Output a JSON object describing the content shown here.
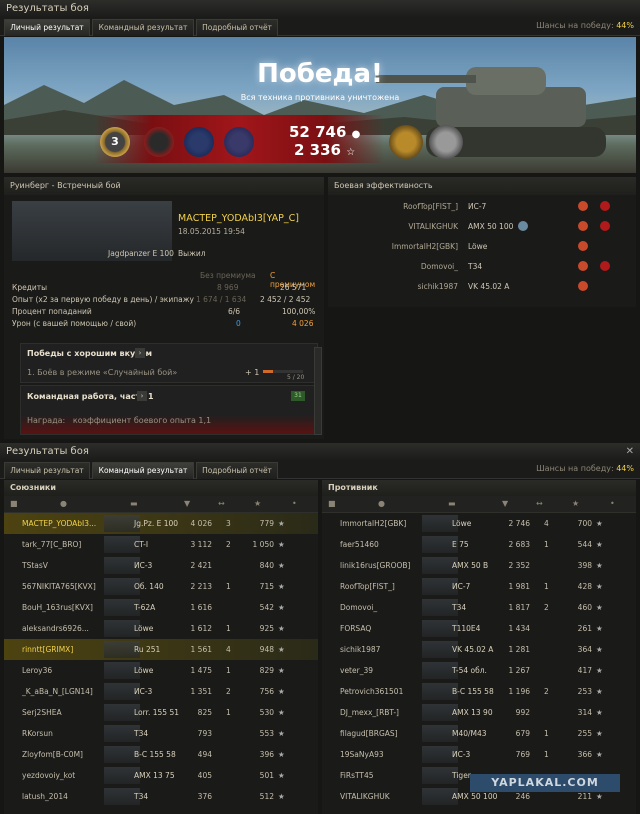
{
  "top_window": {
    "title": "Результаты боя",
    "tabs": [
      "Личный результат",
      "Командный результат",
      "Подробный отчёт"
    ],
    "chance_label": "Шансы на победу:",
    "chance_value": "44%",
    "banner": {
      "title": "Победа!",
      "subtitle": "Вся техника противника уничтожена",
      "credits": "52 746",
      "xp": "2 336",
      "mastery": "3"
    },
    "left_panel": {
      "header": "Руинберг - Встречный бой",
      "player": "МАСТЕР_YODAbI3[YAP_C]",
      "date": "18.05.2015 19:54",
      "tank": "Jagdpanzer E 100",
      "status": "Выжил",
      "col_base": "Без премиума",
      "col_prem": "С премиумом",
      "stats": [
        {
          "label": "Кредиты",
          "base": "8 969",
          "prem": "26 571"
        },
        {
          "label": "Опыт (x2 за первую победу в день) / экипажу",
          "base": "1 674 / 1 634",
          "prem": "2 452 / 2 452"
        },
        {
          "label": "Процент попаданий",
          "base": "6/6",
          "prem": "100,00%"
        },
        {
          "label": "Урон (с вашей помощью / свой)",
          "base": "0",
          "prem": "4 026"
        }
      ],
      "quest1_title": "Победы с хорошим вкусом",
      "quest1_line": "1. Боёв в режиме «Случайный бой»",
      "quest1_plus": "+ 1",
      "quest1_progress": "5 / 20",
      "quest1_fill": 0.25,
      "quest2_title": "Командная работа, часть 1",
      "quest2_badge": "31",
      "quest2_reward_label": "Награда:",
      "quest2_reward": "коэффициент боевого опыта 1,1"
    },
    "right_panel": {
      "header": "Боевая эффективность",
      "rows": [
        {
          "player": "RoofTop[FIST_]",
          "tank": "ИС-7"
        },
        {
          "player": "VITALIKGHUK",
          "tank": "AMX 50 100"
        },
        {
          "player": "ImmortalH2[GBK]",
          "tank": "Löwe"
        },
        {
          "player": "Domovoi_",
          "tank": "T34"
        },
        {
          "player": "sichik1987",
          "tank": "VK 45.02 A"
        }
      ]
    }
  },
  "bottom_window": {
    "title": "Результаты боя",
    "tabs": [
      "Личный результат",
      "Командный результат",
      "Подробный отчёт"
    ],
    "chance_label": "Шансы на победу:",
    "chance_value": "44%",
    "allies_title": "Союзники",
    "enemies_title": "Противник",
    "allies": [
      {
        "name": "МАСТЕР_YODAbI3...",
        "tank": "Jg.Pz. E 100",
        "dmg": "4 026",
        "kills": "3",
        "xp": "779",
        "hl": true
      },
      {
        "name": "tark_77[C_BRO]",
        "tank": "CT-I",
        "dmg": "3 112",
        "kills": "2",
        "xp": "1 050"
      },
      {
        "name": "TStasV",
        "tank": "ИС-3",
        "dmg": "2 421",
        "kills": "",
        "xp": "840"
      },
      {
        "name": "567NIKITA765[KVX]",
        "tank": "Об. 140",
        "dmg": "2 213",
        "kills": "1",
        "xp": "715"
      },
      {
        "name": "BouH_163rus[KVX]",
        "tank": "T-62A",
        "dmg": "1 616",
        "kills": "",
        "xp": "542"
      },
      {
        "name": "aleksandrs6926...",
        "tank": "Löwe",
        "dmg": "1 612",
        "kills": "1",
        "xp": "925"
      },
      {
        "name": "rinntt[GRIMX]",
        "tank": "Ru 251",
        "dmg": "1 561",
        "kills": "4",
        "xp": "948",
        "hl": true
      },
      {
        "name": "Leroy36",
        "tank": "Löwe",
        "dmg": "1 475",
        "kills": "1",
        "xp": "829"
      },
      {
        "name": "_K_aBa_N_[LGN14]",
        "tank": "ИС-3",
        "dmg": "1 351",
        "kills": "2",
        "xp": "756"
      },
      {
        "name": "Serj2SHEA",
        "tank": "Lorr. 155 51",
        "dmg": "825",
        "kills": "1",
        "xp": "530"
      },
      {
        "name": "RKorsun",
        "tank": "T34",
        "dmg": "793",
        "kills": "",
        "xp": "553"
      },
      {
        "name": "Zloyfom[B-C0M]",
        "tank": "B-C 155 58",
        "dmg": "494",
        "kills": "",
        "xp": "396"
      },
      {
        "name": "yezdovoiy_kot",
        "tank": "AMX 13 75",
        "dmg": "405",
        "kills": "",
        "xp": "501"
      },
      {
        "name": "latush_2014",
        "tank": "T34",
        "dmg": "376",
        "kills": "",
        "xp": "512"
      }
    ],
    "enemies": [
      {
        "name": "ImmortalH2[GBK]",
        "tank": "Löwe",
        "dmg": "2 746",
        "kills": "4",
        "xp": "700"
      },
      {
        "name": "faer51460",
        "tank": "E 75",
        "dmg": "2 683",
        "kills": "1",
        "xp": "544"
      },
      {
        "name": "linik16rus[GROOB]",
        "tank": "AMX 50 B",
        "dmg": "2 352",
        "kills": "",
        "xp": "398"
      },
      {
        "name": "RoofTop[FIST_]",
        "tank": "ИС-7",
        "dmg": "1 981",
        "kills": "1",
        "xp": "428"
      },
      {
        "name": "Domovoi_",
        "tank": "T34",
        "dmg": "1 817",
        "kills": "2",
        "xp": "460"
      },
      {
        "name": "FORSAQ",
        "tank": "T110E4",
        "dmg": "1 434",
        "kills": "",
        "xp": "261"
      },
      {
        "name": "sichik1987",
        "tank": "VK 45.02 A",
        "dmg": "1 281",
        "kills": "",
        "xp": "364"
      },
      {
        "name": "veter_39",
        "tank": "T-54 обл.",
        "dmg": "1 267",
        "kills": "",
        "xp": "417"
      },
      {
        "name": "Petrovich361501",
        "tank": "B-C 155 58",
        "dmg": "1 196",
        "kills": "2",
        "xp": "253"
      },
      {
        "name": "DJ_mexx_[RBT-]",
        "tank": "AMX 13 90",
        "dmg": "992",
        "kills": "",
        "xp": "314"
      },
      {
        "name": "filagud[BRGAS]",
        "tank": "M40/M43",
        "dmg": "679",
        "kills": "1",
        "xp": "255"
      },
      {
        "name": "19SaNyA93",
        "tank": "ИС-3",
        "dmg": "769",
        "kills": "1",
        "xp": "366"
      },
      {
        "name": "FiRsTT45",
        "tank": "Tiger",
        "dmg": "",
        "kills": "",
        "xp": ""
      },
      {
        "name": "VITALIKGHUK",
        "tank": "AMX 50 100",
        "dmg": "246",
        "kills": "",
        "xp": "211"
      }
    ],
    "watermark": "YAPLAKAL.COM"
  },
  "colors": {
    "accent_gold": "#f2d24a",
    "banner_red": "#a1161a"
  }
}
